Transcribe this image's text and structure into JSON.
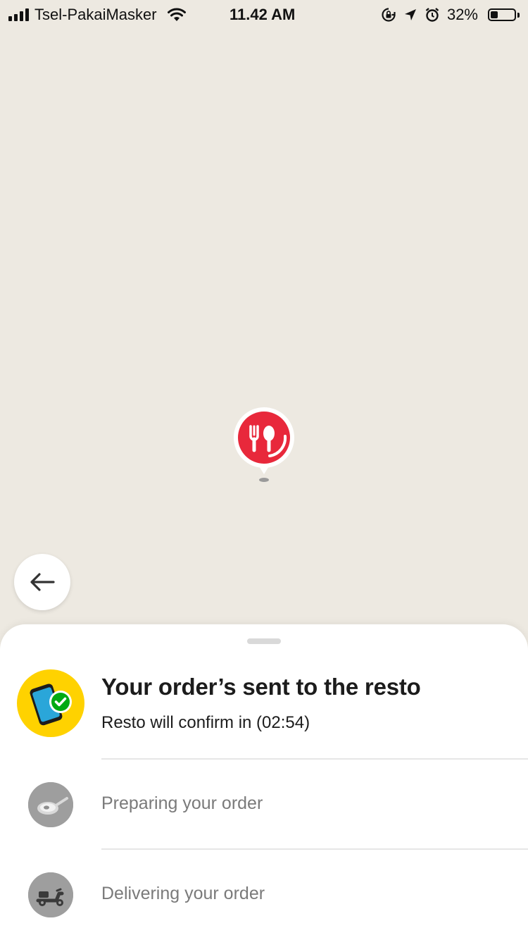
{
  "status_bar": {
    "carrier": "Tsel-PakaiMasker",
    "time": "11.42 AM",
    "battery_percent": "32%",
    "battery_level": 0.32,
    "icons": [
      "signal-icon",
      "wifi-icon",
      "orientation-lock-icon",
      "location-arrow-icon",
      "alarm-icon",
      "battery-icon"
    ]
  },
  "map": {
    "marker_icon": "restaurant-fork-spoon-icon",
    "marker_color": "#e8283b",
    "back_icon": "arrow-left-icon"
  },
  "order_status": {
    "current": {
      "title": "Your order’s sent to the resto",
      "subtitle": "Resto will confirm in (02:54)",
      "icon": "phone-check-icon",
      "icon_bg": "#ffd200"
    },
    "steps": [
      {
        "label": "Preparing your order",
        "icon": "cooking-pan-icon"
      },
      {
        "label": "Delivering your order",
        "icon": "scooter-icon"
      }
    ]
  }
}
